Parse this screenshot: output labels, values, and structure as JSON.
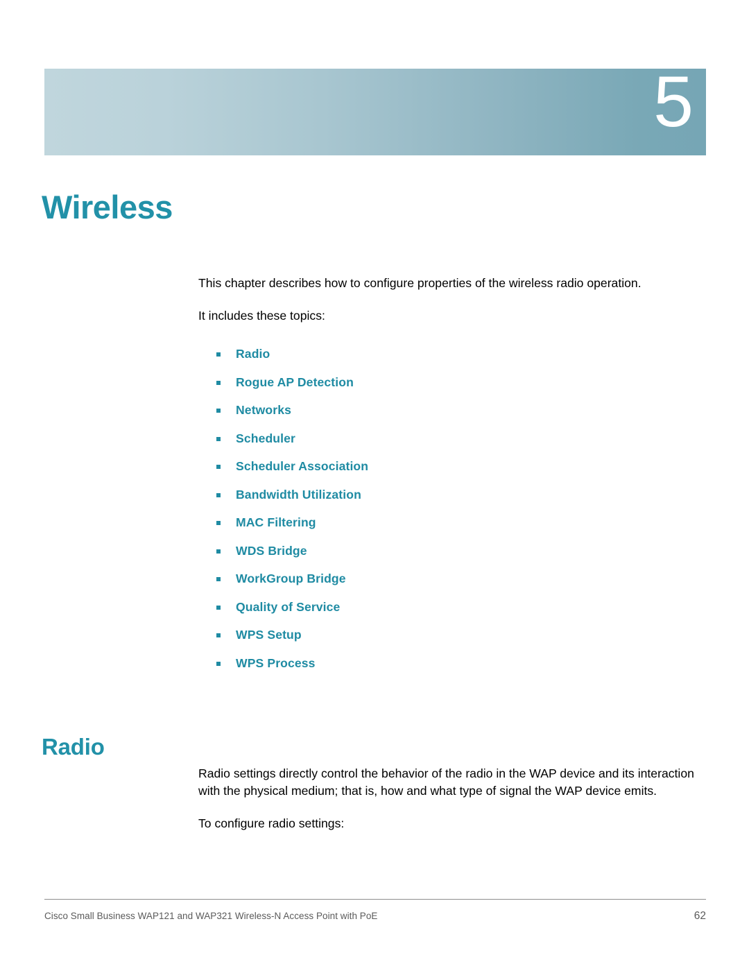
{
  "chapter": {
    "number": "5",
    "title": "Wireless"
  },
  "intro": {
    "paragraph_1": "This chapter describes how to configure properties of the wireless radio operation.",
    "paragraph_2": "It includes these topics:"
  },
  "topics": [
    {
      "label": "Radio"
    },
    {
      "label": "Rogue AP Detection"
    },
    {
      "label": "Networks"
    },
    {
      "label": "Scheduler"
    },
    {
      "label": "Scheduler Association"
    },
    {
      "label": "Bandwidth Utilization"
    },
    {
      "label": "MAC Filtering"
    },
    {
      "label": "WDS Bridge"
    },
    {
      "label": "WorkGroup Bridge"
    },
    {
      "label": "Quality of Service"
    },
    {
      "label": "WPS Setup"
    },
    {
      "label": "WPS Process"
    }
  ],
  "section": {
    "heading": "Radio",
    "paragraph_1": "Radio settings directly control the behavior of the radio in the WAP device and its interaction with the physical medium; that is, how and what type of signal the WAP device emits.",
    "paragraph_2": "To configure radio settings:"
  },
  "footer": {
    "text": "Cisco Small Business WAP121 and WAP321 Wireless-N Access Point with PoE",
    "page_number": "62"
  },
  "colors": {
    "accent_teal": "#2291a8",
    "link_teal": "#1f8ba3",
    "banner_light": "#c0d6dd",
    "banner_dark": "#76a6b5",
    "footer_gray": "#5a5a5a"
  }
}
